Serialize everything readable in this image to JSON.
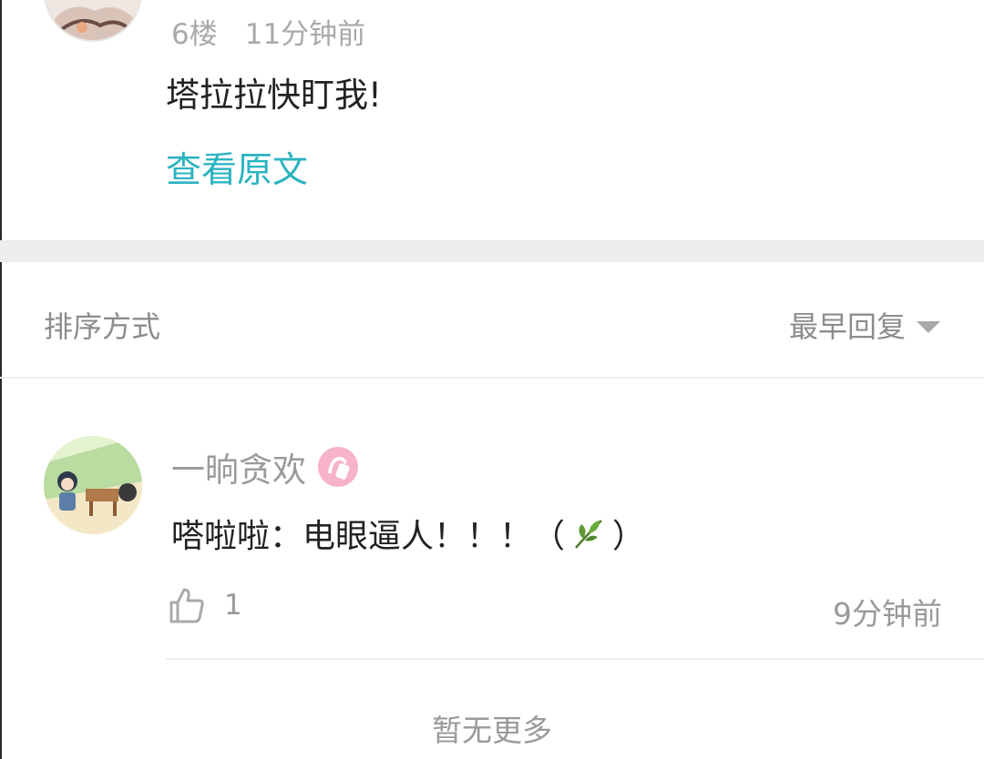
{
  "prev_comment": {
    "floor": "6楼",
    "time": "11分钟前",
    "text": "塔拉拉快盯我!",
    "view_original": "查看原文"
  },
  "sort": {
    "label": "排序方式",
    "selected": "最早回复"
  },
  "reply": {
    "username": "一晌贪欢",
    "text_before": "嗒啦啦：电眼逼人！！！（",
    "text_after": "）",
    "emoji_icon": "leaf-icon",
    "like_count": "1",
    "time": "9分钟前"
  },
  "footer": {
    "no_more": "暂无更多"
  },
  "colors": {
    "link": "#2bb3c0",
    "meta_text": "#9a9a9a",
    "body_text": "#222222",
    "badge_pink": "#f7b3c8",
    "divider": "#ededed"
  }
}
